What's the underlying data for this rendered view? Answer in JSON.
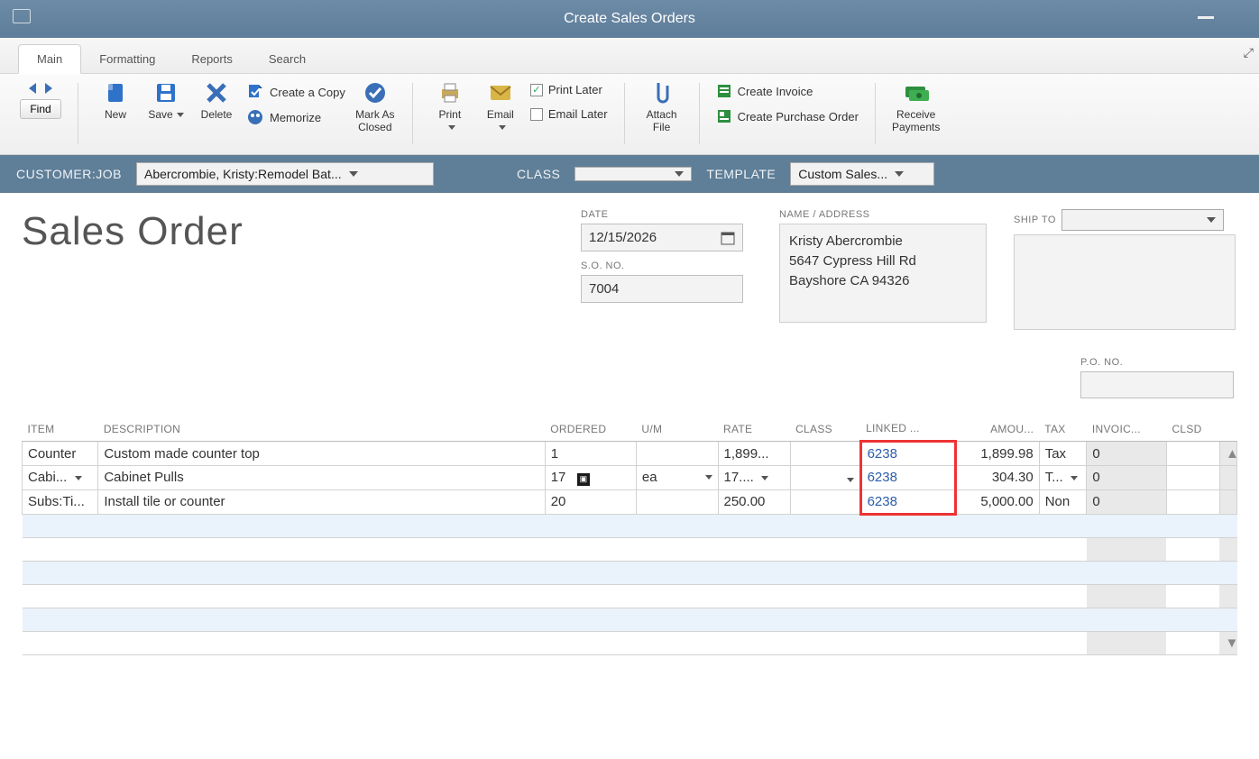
{
  "window": {
    "title": "Create Sales Orders"
  },
  "tabs": {
    "items": [
      "Main",
      "Formatting",
      "Reports",
      "Search"
    ],
    "active": 0
  },
  "ribbon": {
    "find": "Find",
    "new": "New",
    "save": "Save",
    "delete": "Delete",
    "createCopy": "Create a Copy",
    "memorize": "Memorize",
    "markClosed": "Mark As\nClosed",
    "print": "Print",
    "email": "Email",
    "printLater": "Print Later",
    "emailLater": "Email Later",
    "attachFile": "Attach\nFile",
    "createInvoice": "Create Invoice",
    "createPO": "Create Purchase Order",
    "receivePayments": "Receive\nPayments"
  },
  "selector": {
    "custLabel": "CUSTOMER:JOB",
    "custValue": "Abercrombie, Kristy:Remodel Bat...",
    "classLabel": "CLASS",
    "classValue": "",
    "templateLabel": "TEMPLATE",
    "templateValue": "Custom Sales..."
  },
  "form": {
    "title": "Sales Order",
    "dateLabel": "DATE",
    "date": "12/15/2026",
    "soLabel": "S.O. NO.",
    "soNo": "7004",
    "nameAddrLabel": "NAME / ADDRESS",
    "nameAddr": "Kristy Abercrombie\n5647 Cypress Hill Rd\nBayshore CA 94326",
    "shipToLabel": "SHIP TO",
    "shipTo": "",
    "pono_label": "P.O. NO.",
    "pono": ""
  },
  "columns": {
    "item": "ITEM",
    "desc": "DESCRIPTION",
    "ordered": "ORDERED",
    "um": "U/M",
    "rate": "RATE",
    "class": "CLASS",
    "linked": "LINKED ...",
    "amount": "AMOU...",
    "tax": "TAX",
    "invoiced": "INVOIC...",
    "clsd": "CLSD"
  },
  "rows": [
    {
      "item": "Counter",
      "desc": "Custom made counter top",
      "ordered": "1",
      "um": "",
      "rate": "1,899...",
      "class": "",
      "linked": "6238",
      "amount": "1,899.98",
      "tax": "Tax",
      "invoiced": "0",
      "clsd": ""
    },
    {
      "item": "Cabi...",
      "desc": "Cabinet Pulls",
      "ordered": "17",
      "um": "ea",
      "rate": "17....",
      "class": "",
      "linked": "6238",
      "amount": "304.30",
      "tax": "T...",
      "invoiced": "0",
      "clsd": "",
      "active": true
    },
    {
      "item": "Subs:Ti...",
      "desc": "Install tile or counter",
      "ordered": "20",
      "um": "",
      "rate": "250.00",
      "class": "",
      "linked": "6238",
      "amount": "5,000.00",
      "tax": "Non",
      "invoiced": "0",
      "clsd": ""
    }
  ]
}
